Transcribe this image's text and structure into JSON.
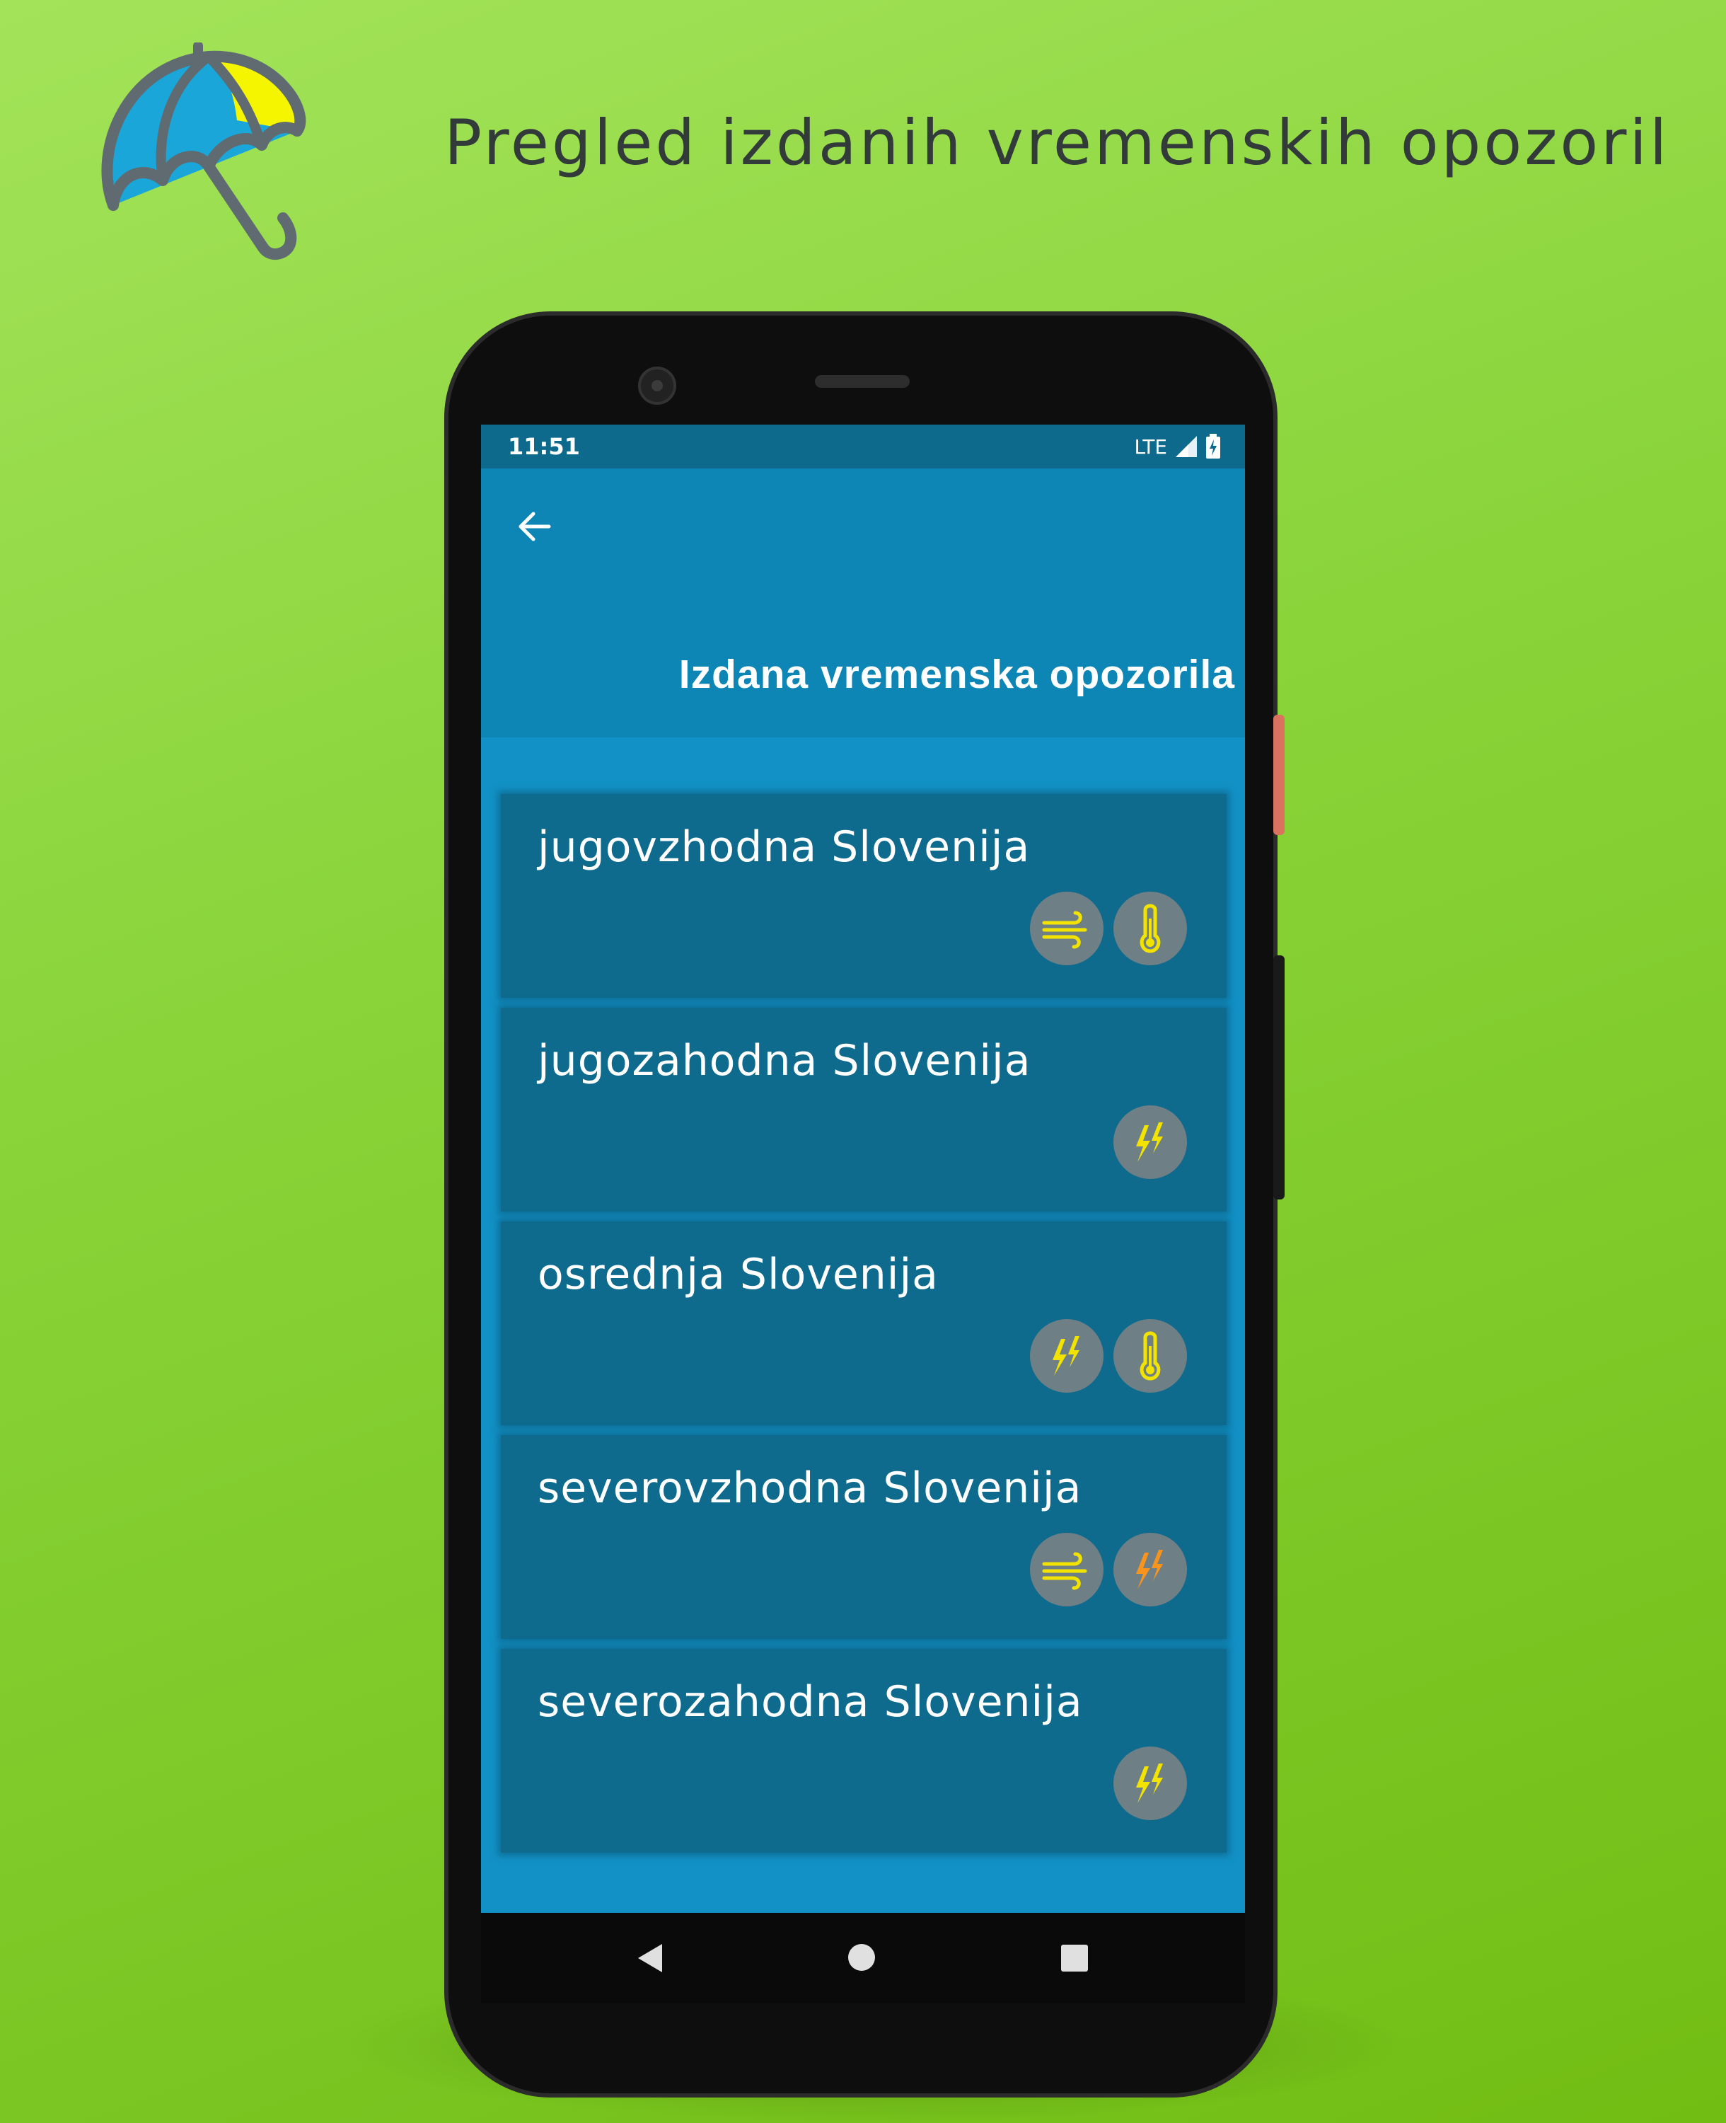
{
  "promo": {
    "title": "Pregled izdanih vremenskih opozoril"
  },
  "status_bar": {
    "time": "11:51",
    "network": "LTE"
  },
  "app_bar": {
    "title": "Izdana vremenska opozorila"
  },
  "warnings": [
    {
      "region": "jugovzhodna Slovenija",
      "icons": [
        "wind-icon",
        "temperature-icon"
      ]
    },
    {
      "region": "jugozahodna Slovenija",
      "icons": [
        "thunderstorm-icon"
      ]
    },
    {
      "region": "osrednja Slovenija",
      "icons": [
        "thunderstorm-icon",
        "temperature-icon"
      ]
    },
    {
      "region": "severovzhodna Slovenija",
      "icons": [
        "wind-icon",
        "thunderstorm-orange-icon"
      ]
    },
    {
      "region": "severozahodna Slovenija",
      "icons": [
        "thunderstorm-icon"
      ]
    }
  ],
  "colors": {
    "background": "#8ad43a",
    "app_bar": "#0e86b5",
    "screen_bg": "#1291c6",
    "card": "#0f6b8d",
    "icon_circle": "#6e7f86",
    "warning_yellow": "#f2e400",
    "warning_orange": "#f7941d"
  }
}
